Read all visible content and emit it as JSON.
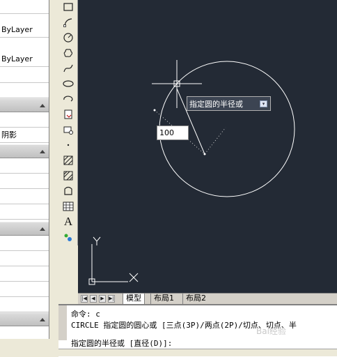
{
  "properties_panel": {
    "rows": [
      {
        "text": ""
      },
      {
        "text": "ByLayer"
      },
      {
        "text": ""
      },
      {
        "text": "ByLayer"
      },
      {
        "text": ""
      },
      {
        "text": ""
      }
    ],
    "section2_row": "",
    "section2_row2": "阴影"
  },
  "toolbar": {
    "tools": [
      "rectangle-icon",
      "arc-icon",
      "circle-icon",
      "revision-cloud-icon",
      "spline-icon",
      "ellipse-icon",
      "ellipse-arc-icon",
      "insert-block-icon",
      "make-block-icon",
      "point-icon",
      "hatch-icon",
      "gradient-icon",
      "region-icon",
      "table-icon",
      "multiline-text-icon",
      "add-selected-icon"
    ],
    "text_tool_label": "A"
  },
  "drawing": {
    "tooltip_text": "指定圆的半径或",
    "tooltip_button": "▾",
    "input_value": "100",
    "ucs_y": "Y",
    "ucs_x": "X"
  },
  "layout_tabs": {
    "tabs": [
      "模型",
      "布局1",
      "布局2"
    ],
    "active": "模型"
  },
  "command_window": {
    "line1": "命令: c",
    "line2": "CIRCLE 指定圆的圆心或 [三点(3P)/两点(2P)/切点、切点、半",
    "line3": "指定圆的半径或 [直径(D)]:"
  },
  "watermark": "Bai经验",
  "colors": {
    "canvas_bg": "#232a35",
    "drawing_line": "#ffffff",
    "panel_bg": "#ece9d8"
  }
}
